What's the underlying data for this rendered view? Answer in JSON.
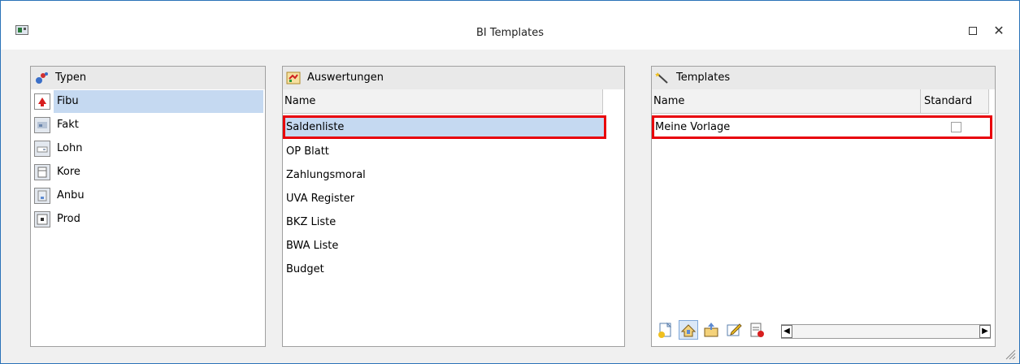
{
  "window": {
    "title": "BI Templates",
    "close_glyph": "✕"
  },
  "typen": {
    "header": "Typen",
    "items": [
      {
        "label": "Fibu",
        "icon": "fibu-icon",
        "selected": true
      },
      {
        "label": "Fakt",
        "icon": "fakt-icon"
      },
      {
        "label": "Lohn",
        "icon": "lohn-icon"
      },
      {
        "label": "Kore",
        "icon": "kore-icon"
      },
      {
        "label": "Anbu",
        "icon": "anbu-icon"
      },
      {
        "label": "Prod",
        "icon": "prod-icon"
      }
    ]
  },
  "auswertungen": {
    "header": "Auswertungen",
    "column": "Name",
    "items": [
      "Saldenliste",
      "OP Blatt",
      "Zahlungsmoral",
      "UVA Register",
      "BKZ Liste",
      "BWA Liste",
      "Budget"
    ],
    "selected_index": 0
  },
  "templates": {
    "header": "Templates",
    "columns": {
      "name": "Name",
      "standard": "Standard"
    },
    "rows": [
      {
        "name": "Meine Vorlage",
        "standard": false
      }
    ],
    "toolbar": [
      "new-template-icon",
      "import-template-icon",
      "export-template-icon",
      "edit-template-icon",
      "delete-template-icon"
    ]
  },
  "colors": {
    "selection": "#c5d9f1",
    "highlight_border": "#e8000a",
    "window_border": "#2a72b8"
  }
}
